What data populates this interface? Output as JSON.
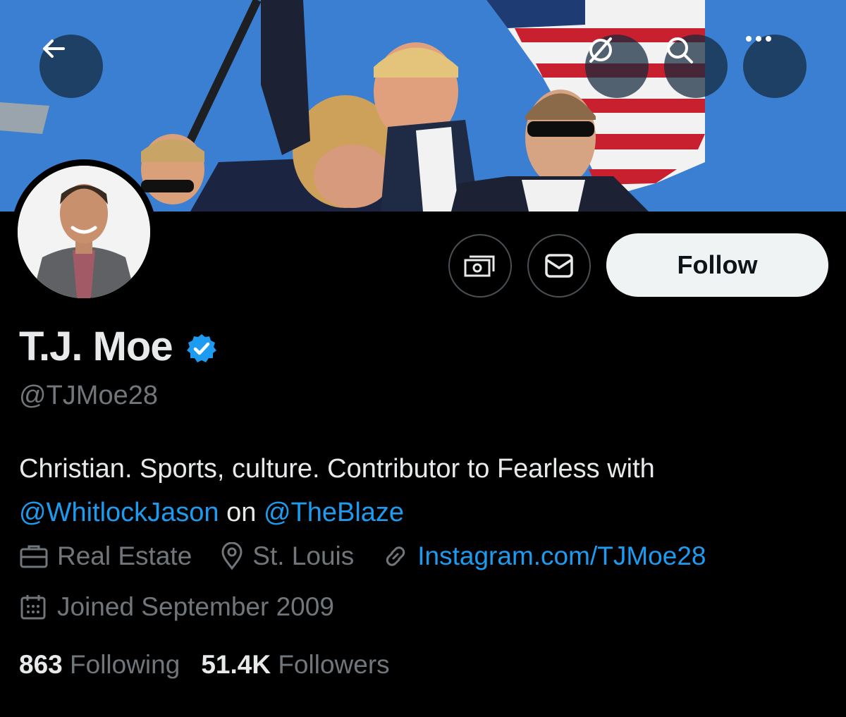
{
  "colors": {
    "background": "#000000",
    "text_primary": "#e7e9ea",
    "text_secondary": "#71767b",
    "link": "#1d9bf0",
    "follow_button_bg": "#eff3f4",
    "verified_badge": "#1d9bf0"
  },
  "header": {
    "back_icon": "arrow-left-icon",
    "grok_icon": "grok-slash-circle-icon",
    "search_icon": "search-icon",
    "more_icon": "more-horizontal-icon"
  },
  "actions": {
    "tip_icon": "money-icon",
    "message_icon": "envelope-icon",
    "follow_label": "Follow"
  },
  "profile": {
    "name": "T.J. Moe",
    "verified_icon": "verified-badge-icon",
    "handle": "@TJMoe28",
    "bio_text_1": "Christian. Sports, culture. Contributor to Fearless with",
    "bio_mention_1": "@WhitlockJason",
    "bio_text_2": " on ",
    "bio_mention_2": "@TheBlaze",
    "category": "Real Estate",
    "location": "St. Louis",
    "website": "Instagram.com/TJMoe28",
    "joined": "Joined September 2009"
  },
  "stats": {
    "following_count": "863",
    "following_label": "Following",
    "followers_count": "51.4K",
    "followers_label": "Followers"
  }
}
